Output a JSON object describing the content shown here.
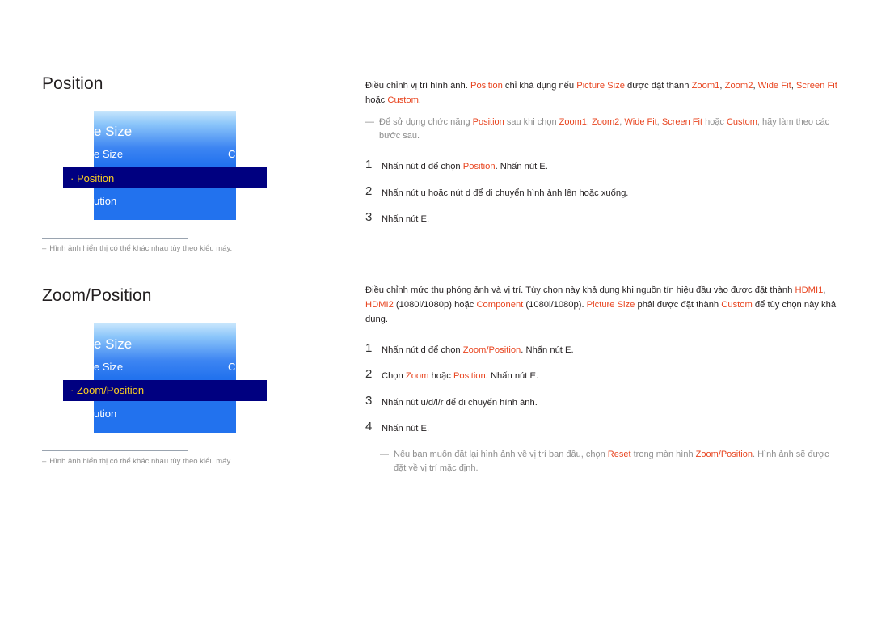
{
  "page": {
    "accent_color": "#e8441f",
    "note_color": "#8d8d8d",
    "osd_highlight_bg": "#000080",
    "osd_highlight_text": "#ffd21e",
    "osd_panel_blue": "#2272ee"
  },
  "sections": [
    {
      "heading": "Position",
      "osd": {
        "title": "e Size",
        "row1_label": "e Size",
        "row1_value": "C",
        "highlight_bullet": "·",
        "highlight_label": "Position",
        "row3_label": "ution"
      },
      "footnote": {
        "dash": "–",
        "text": "Hình ảnh hiển thị có thể khác nhau tùy theo kiểu máy."
      },
      "intro": {
        "t1": "Điều chỉnh vị trí hình ảnh. ",
        "k1": "Position",
        "t2": " chỉ khả dụng nếu ",
        "k2": "Picture Size",
        "t3": " được đặt thành ",
        "k3": "Zoom1",
        "t4": ", ",
        "k4": "Zoom2",
        "t5": ", ",
        "k5": "Wide Fit",
        "t6": ", ",
        "k6": "Screen Fit",
        "t7": " hoặc ",
        "k7": "Custom",
        "t8": "."
      },
      "note": {
        "dash": "—",
        "t1": "Để sử dụng chức năng ",
        "k1": "Position",
        "t2": " sau khi chọn ",
        "k2": "Zoom1",
        "t3": ", ",
        "k3": "Zoom2",
        "t4": ", ",
        "k4": "Wide Fit",
        "t5": ", ",
        "k5": "Screen Fit",
        "t6": " hoặc ",
        "k6": "Custom",
        "t7": ", hãy làm theo các bước sau."
      },
      "steps": [
        {
          "num": "1",
          "t1": "Nhấn nút d  để chọn ",
          "k1": "Position",
          "t2": ". Nhấn nút E."
        },
        {
          "num": "2",
          "t1": "Nhấn nút u  hoặc nút d  để di chuyển hình ảnh lên hoặc xuống.",
          "k1": "",
          "t2": ""
        },
        {
          "num": "3",
          "t1": "Nhấn nút E.",
          "k1": "",
          "t2": ""
        }
      ]
    },
    {
      "heading": "Zoom/Position",
      "osd": {
        "title": "e Size",
        "row1_label": "e Size",
        "row1_value": "C",
        "highlight_bullet": "·",
        "highlight_label": "Zoom/Position",
        "row3_label": "ution"
      },
      "footnote": {
        "dash": "–",
        "text": "Hình ảnh hiển thị có thể khác nhau tùy theo kiểu máy."
      },
      "intro": {
        "t1": "Điều chỉnh mức thu phóng ảnh và vị trí. Tùy chọn này khả dụng khi nguồn tín hiệu đầu vào được đặt thành ",
        "k1": "HDMI1",
        "t2": ", ",
        "k2": "HDMI2",
        "t3": " (1080i/1080p) hoặc ",
        "k3": "Component",
        "t4": " (1080i/1080p). ",
        "k4": "Picture Size",
        "t5": " phải được đặt thành ",
        "k5": "Custom",
        "t6": " để tùy chọn này khả dụng."
      },
      "steps": [
        {
          "num": "1",
          "t1": "Nhấn nút d  để chọn ",
          "k1": "Zoom/Position",
          "t2": ". Nhấn nút E."
        },
        {
          "num": "2",
          "t1": "Chọn ",
          "k1": "Zoom",
          "t2": " hoặc ",
          "k2": "Position",
          "t3": ". Nhấn nút E."
        },
        {
          "num": "3",
          "t1": "Nhấn nút u/d/l/r      để di chuyển hình ảnh.",
          "k1": "",
          "t2": ""
        },
        {
          "num": "4",
          "t1": "Nhấn nút E.",
          "k1": "",
          "t2": ""
        }
      ],
      "endnote": {
        "dash": "—",
        "t1": "Nếu bạn muốn đặt lại hình ảnh về vị trí ban đầu, chọn ",
        "k1": "Reset",
        "t2": " trong màn hình ",
        "k2": "Zoom/Position",
        "t3": ". Hình ảnh sẽ được đặt về vị trí mặc định."
      }
    }
  ]
}
